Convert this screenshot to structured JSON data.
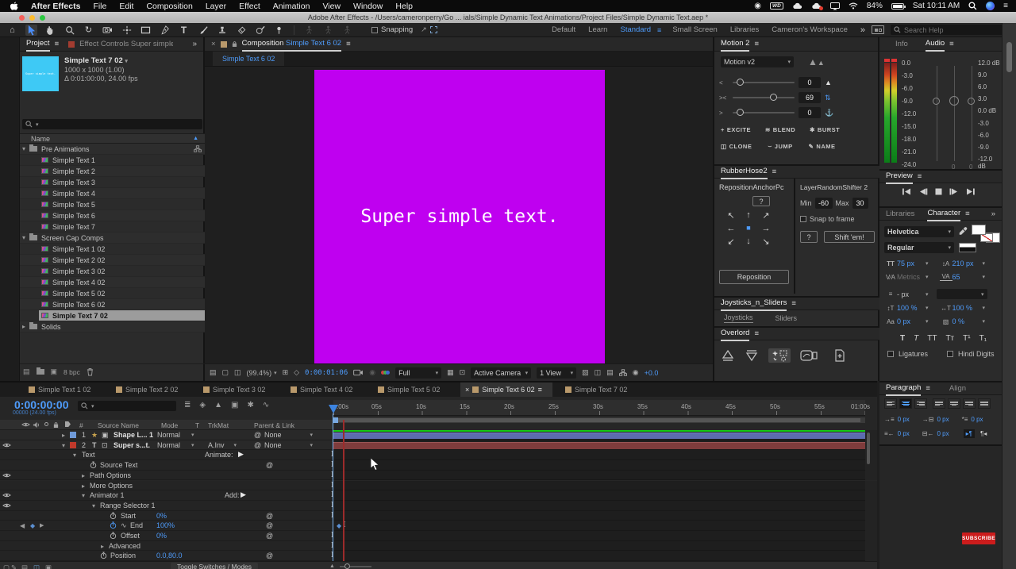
{
  "colors": {
    "accent_blue": "#4e9bfa",
    "canvas_magenta": "#bf00f0",
    "thumb_cyan": "#3ec9f5",
    "cached_green": "#16c916",
    "layer_bar_blue": "#5c6cae",
    "layer_bar_maroon": "#7e3c3c",
    "cti_red": "#a32f2f",
    "subscribe_red": "#cc1c1c"
  },
  "menubar": {
    "app_name": "After Effects",
    "items": [
      "File",
      "Edit",
      "Composition",
      "Layer",
      "Effect",
      "Animation",
      "View",
      "Window",
      "Help"
    ],
    "wd_badge": "WD",
    "battery_pct": "84%",
    "clock": "Sat 10:11 AM"
  },
  "titlebar": {
    "title": "Adobe After Effects - /Users/cameronperry/Go ... ials/Simple Dynamic Text Animations/Project Files/Simple Dynamic Text.aep *"
  },
  "toolbar": {
    "snapping_label": "Snapping",
    "workspaces": [
      "Default",
      "Learn",
      "Standard",
      "Small Screen",
      "Libraries",
      "Cameron's Workspace"
    ],
    "active_workspace": "Standard",
    "search_placeholder": "Search Help"
  },
  "project": {
    "tab_label": "Project",
    "effect_controls_tab": "Effect Controls Super simple text",
    "thumb_text": "Super simple text.",
    "comp_name": "Simple Text 7 02",
    "comp_size": "1000 x 1000 (1.00)",
    "comp_duration": "Δ 0:01:00:00, 24.00 fps",
    "name_column": "Name",
    "footer_bpc": "8 bpc",
    "items": [
      {
        "label": "Pre Animations"
      },
      {
        "label": "Simple Text 1"
      },
      {
        "label": "Simple Text 2"
      },
      {
        "label": "Simple Text 3"
      },
      {
        "label": "Simple Text 4"
      },
      {
        "label": "Simple Text 5"
      },
      {
        "label": "Simple Text 6"
      },
      {
        "label": "Simple Text 7"
      },
      {
        "label": "Screen Cap Comps"
      },
      {
        "label": "Simple Text 1 02"
      },
      {
        "label": "Simple Text 2 02"
      },
      {
        "label": "Simple Text 3 02"
      },
      {
        "label": "Simple Text 4 02"
      },
      {
        "label": "Simple Text 5 02"
      },
      {
        "label": "Simple Text 6 02"
      },
      {
        "label": "Simple Text 7 02"
      },
      {
        "label": "Solids"
      }
    ]
  },
  "viewer": {
    "close": "×",
    "panel_label": "Composition",
    "comp_name": "Simple Text 6 02",
    "tab_label": "Simple Text 6 02",
    "canvas_text": "Super simple text.",
    "zoom": "(99.4%)",
    "timecode": "0:00:01:06",
    "resolution": "Full",
    "camera": "Active Camera",
    "view_count": "1 View",
    "exposure": "+0.0"
  },
  "motion": {
    "title": "Motion 2",
    "preset": "Motion v2",
    "slider1": "0",
    "slider2": "69",
    "slider3": "0",
    "buttons": [
      "EXCITE",
      "BLEND",
      "BURST",
      "CLONE",
      "JUMP",
      "NAME"
    ]
  },
  "rubberhose": {
    "title": "RubberHose2"
  },
  "reposition": {
    "title": "RepositionAnchorPc",
    "help": "?",
    "button": "Reposition"
  },
  "shifter": {
    "title": "LayerRandomShifter 2",
    "min_label": "Min",
    "min_value": "-60",
    "max_label": "Max",
    "max_value": "30",
    "snap_label": "Snap to frame",
    "help": "?",
    "button": "Shift 'em!"
  },
  "joysticks": {
    "title": "Joysticks_n_Sliders",
    "tab1": "Joysticks",
    "tab2": "Sliders"
  },
  "overlord": {
    "title": "Overlord"
  },
  "audio": {
    "tab_info": "Info",
    "tab_audio": "Audio",
    "left_scale": [
      "0.0",
      "-3.0",
      "-6.0",
      "-9.0",
      "-12.0",
      "-15.0",
      "-18.0",
      "-21.0",
      "-24.0"
    ],
    "right_scale": [
      "12.0 dB",
      "9.0",
      "6.0",
      "3.0",
      "0.0 dB",
      "-3.0",
      "-6.0",
      "-9.0",
      "-12.0 dB"
    ],
    "readout1": "0",
    "readout2": "0"
  },
  "preview": {
    "title": "Preview"
  },
  "character": {
    "tab_libraries": "Libraries",
    "tab_character": "Character",
    "font_family": "Helvetica",
    "font_style": "Regular",
    "font_size": "75 px",
    "leading": "210 px",
    "kerning": "Metrics",
    "tracking": "65",
    "stroke_width": "- px",
    "vertical_scale": "100 %",
    "horizontal_scale": "100 %",
    "baseline_shift": "0 px",
    "tsume": "0 %",
    "px_label": "px",
    "style_buttons": [
      "T",
      "T",
      "TT",
      "Tᴛ",
      "T¹",
      "T₁"
    ],
    "ligatures_label": "Ligatures",
    "hindi_label": "Hindi Digits"
  },
  "paragraph": {
    "tab_paragraph": "Paragraph",
    "tab_align": "Align",
    "indent_left": "0 px",
    "space_before": "0 px",
    "first_line": "0 px",
    "indent_right": "0 px",
    "space_after": "0 px"
  },
  "timeline": {
    "timecode": "0:00:00:00",
    "timecode_sub": "00000 (24.00 fps)",
    "tabs": [
      "Simple Text 1 02",
      "Simple Text 2 02",
      "Simple Text 3 02",
      "Simple Text 4 02",
      "Simple Text 5 02",
      "Simple Text 6 02",
      "Simple Text 7 02"
    ],
    "columns": {
      "num": "#",
      "source_name": "Source Name",
      "mode": "Mode",
      "t": "T",
      "trkmat": "TrkMat",
      "parent": "Parent & Link"
    },
    "ruler": [
      ":00s",
      "05s",
      "10s",
      "15s",
      "20s",
      "25s",
      "30s",
      "35s",
      "40s",
      "45s",
      "50s",
      "55s",
      "01:00s"
    ],
    "layer1": {
      "num": "1",
      "name": "Shape L... 1",
      "mode": "Normal",
      "parent": "None"
    },
    "layer2": {
      "num": "2",
      "name": "Super s...t.",
      "mode": "Normal",
      "trkmat": "A.Inv",
      "parent": "None"
    },
    "text_group": "Text",
    "animate_label": "Animate:",
    "add_label": "Add:",
    "props": {
      "source_text": "Source Text",
      "path_options": "Path Options",
      "more_options": "More Options",
      "animator": "Animator 1",
      "range_selector": "Range Selector 1",
      "start_label": "Start",
      "start_value": "0%",
      "end_label": "End",
      "end_value": "100%",
      "offset_label": "Offset",
      "offset_value": "0%",
      "advanced": "Advanced",
      "position_label": "Position",
      "position_value": "0.0,80.0"
    },
    "footer_button": "Toggle Switches / Modes"
  },
  "subscribe_label": "SUBSCRIBE",
  "icons": {
    "hamburger": "≡",
    "caret": "▾",
    "chev_right": "▸",
    "chev_down": "▾",
    "chevrons": "»",
    "close": "×",
    "home": "⌂",
    "rotate_tool": "↻",
    "type_tool": "T",
    "star": "★",
    "box": "▣",
    "boxed_star": "⊡",
    "sort_up": "▲",
    "record": "◉",
    "list_menu": "≡",
    "lt": "<",
    "ltgt": "><",
    "gt": ">",
    "rocket": "▲",
    "updown": "⇅",
    "anchor": "⚓",
    "plus": "+",
    "waves": "≋",
    "burst": "✱",
    "clone": "◫",
    "jump": "⌣",
    "pencil": "✎",
    "nw": "↖",
    "n": "↑",
    "ne": "↗",
    "w": "←",
    "e": "→",
    "sw": "↙",
    "s": "↓",
    "se": "↘",
    "sq": "■",
    "at": "@",
    "kf": "◆",
    "nav_l": "◀",
    "nav_r": "▶",
    "graph": "∿",
    "mountain": "▲",
    "tl_flowchart": "≣",
    "tl_draft3d": "◈",
    "tl_shy": "▲",
    "tl_frameblend": "▣",
    "tl_motionblur": "✱",
    "tl_graph": "∿",
    "v_always": "▤",
    "v_display": "▢",
    "v_split": "◫",
    "v_grid": "⊞",
    "v_mask": "◇",
    "v_channel": "◉",
    "v_roi": "▦",
    "v_target": "⊡",
    "v_misc": "▧",
    "v_plus": "+",
    "tt": "TT",
    "leading_ic": "↕A",
    "va1": "V∕A",
    "va2": "VA",
    "stroke_list": "≡",
    "vert_ic": "↕T",
    "horiz_ic": "↔T",
    "baseline_ic": "Aa",
    "tsume_ic": "▧",
    "pi1": "→≡",
    "pi2": "→⊟",
    "pi3": "*≡",
    "pi4": "≡←",
    "pi5": "⊟←",
    "dir1": "▸¶",
    "dir2": "¶◂",
    "ftr1": "▤",
    "ftr2": "◫",
    "ftr3": "▣",
    "gutter1": "▢",
    "gutter2": "✎"
  }
}
